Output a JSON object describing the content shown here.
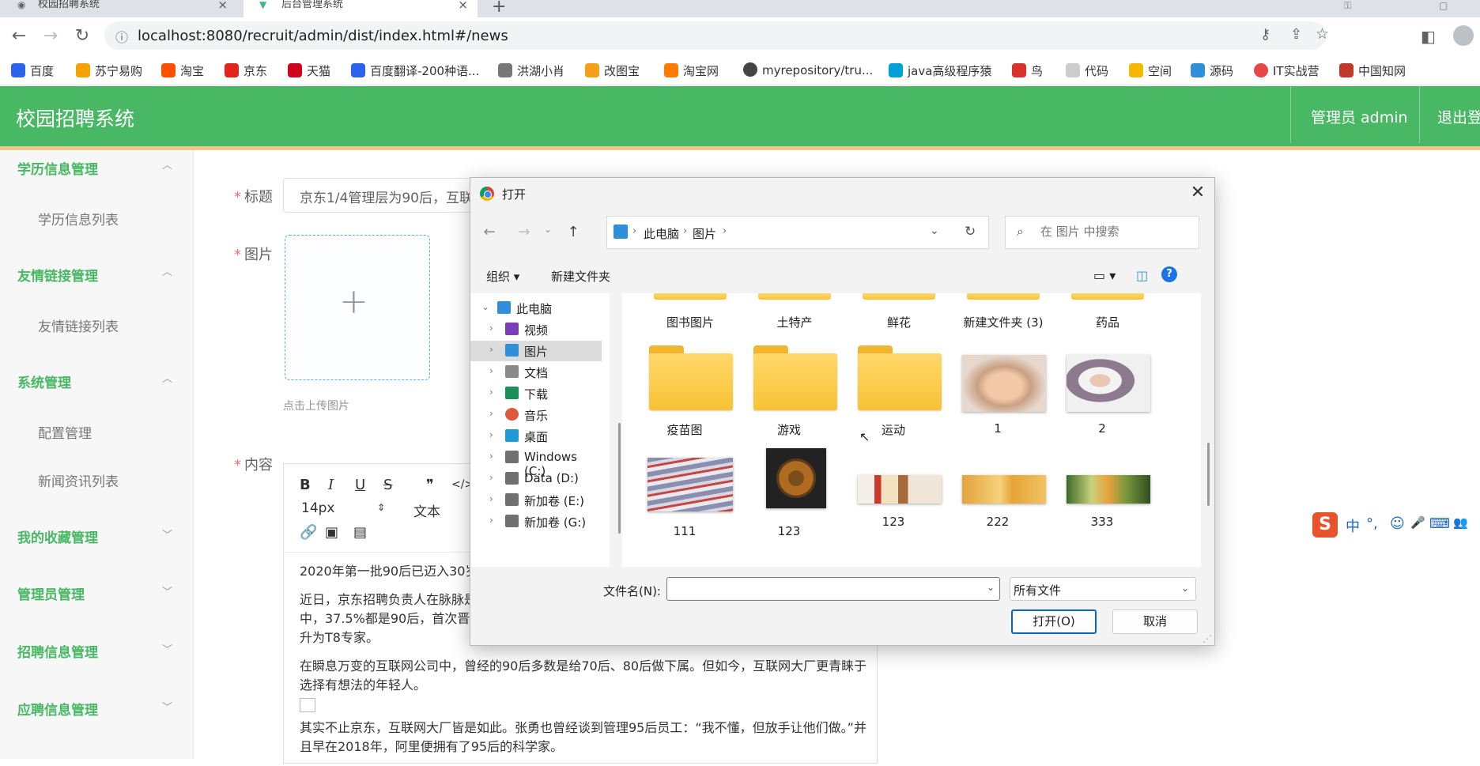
{
  "browser": {
    "tabs": [
      {
        "title": "校园招聘系统"
      },
      {
        "title": "后台管理系统"
      }
    ],
    "new_tab": "+",
    "url": "localhost:8080/recruit/admin/dist/index.html#/news",
    "bookmarks": [
      {
        "label": "百度",
        "color": "#2d63e8"
      },
      {
        "label": "苏宁易购",
        "color": "#f4a300"
      },
      {
        "label": "淘宝",
        "color": "#ff5000"
      },
      {
        "label": "京东",
        "color": "#e1251b"
      },
      {
        "label": "天猫",
        "color": "#d0021b"
      },
      {
        "label": "百度翻译-200种语...",
        "color": "#2d63e8"
      },
      {
        "label": "洪湖小肖",
        "color": "#777777"
      },
      {
        "label": "改图宝",
        "color": "#f6a01a"
      },
      {
        "label": "淘宝网",
        "color": "#ff7a00"
      },
      {
        "label": "myrepository/tru...",
        "color": "#444444"
      },
      {
        "label": "java高级程序猿",
        "color": "#00a1d6"
      },
      {
        "label": "鸟",
        "color": "#d8322a"
      },
      {
        "label": "代码",
        "color": "#cccccc"
      },
      {
        "label": "空间",
        "color": "#f5b700"
      },
      {
        "label": "源码",
        "color": "#2f8fd8"
      },
      {
        "label": "IT实战营",
        "color": "#e84545"
      },
      {
        "label": "中国知网",
        "color": "#c0392b"
      }
    ]
  },
  "app": {
    "title": "校园招聘系统",
    "admin_label": "管理员 admin",
    "logout_label": "退出登录",
    "brand_color": "#48b864"
  },
  "sidebar": {
    "groups": [
      {
        "title": "学历信息管理",
        "items": [
          "学历信息列表"
        ]
      },
      {
        "title": "友情链接管理",
        "items": [
          "友情链接列表"
        ]
      },
      {
        "title": "系统管理",
        "items": [
          "配置管理",
          "新闻资讯列表"
        ]
      },
      {
        "title": "我的收藏管理",
        "items": []
      },
      {
        "title": "管理员管理",
        "items": []
      },
      {
        "title": "招聘信息管理",
        "items": []
      },
      {
        "title": "应聘信息管理",
        "items": []
      }
    ]
  },
  "form": {
    "title_label": "标题",
    "title_value": "京东1/4管理层为90后，互联",
    "image_label": "图片",
    "upload_tip": "点击上传图片",
    "content_label": "内容",
    "required_mark": "*",
    "toolbar": {
      "bold": "B",
      "italic": "I",
      "underline": "U",
      "strike": "S",
      "quote": "❞",
      "code": "</>",
      "font_size": "14px",
      "font_size_arrow": "⇕",
      "text": "文本"
    },
    "content_paragraphs": [
      "2020年第一批90后已迈入30岁，人。",
      "近日，京东招聘负责人在脉脉是内部培养的，1/4以上的管理者都是90后。并且在2020年年初的晋升中，37.5%都是90后，首次晋升的95后，占比达到11.7%。据悉，更有技术类员工，在毕业3年便晋升为T8专家。",
      "在瞬息万变的互联网公司中，曾经的90后多数是给70后、80后做下属。但如今，互联网大厂更青睐于选择有想法的年轻人。",
      "其实不止京东，互联网大厂皆是如此。张勇也曾经谈到管理95后员工：“我不懂，但放手让他们做。”并且早在2018年，阿里便拥有了95后的科学家。"
    ]
  },
  "file_dialog": {
    "title": "打开",
    "breadcrumb": [
      "此电脑",
      "图片"
    ],
    "search_placeholder": "在 图片 中搜索",
    "organize": "组织",
    "new_folder": "新建文件夹",
    "help": "?",
    "tree": [
      {
        "label": "此电脑",
        "color": "#2f8fd8",
        "expanded": true
      },
      {
        "label": "视频",
        "color": "#7a3fb8"
      },
      {
        "label": "图片",
        "color": "#2f8fd8",
        "selected": true
      },
      {
        "label": "文档",
        "color": "#8a8a8a"
      },
      {
        "label": "下载",
        "color": "#1a8f5a"
      },
      {
        "label": "音乐",
        "color": "#e0583a"
      },
      {
        "label": "桌面",
        "color": "#1e9ad6"
      },
      {
        "label": "Windows (C:)",
        "color": "#707070"
      },
      {
        "label": "Data (D:)",
        "color": "#707070"
      },
      {
        "label": "新加卷 (E:)",
        "color": "#707070"
      },
      {
        "label": "新加卷 (G:)",
        "color": "#707070"
      }
    ],
    "items_row1": [
      "图书图片",
      "土特产",
      "鲜花",
      "新建文件夹 (3)",
      "药品"
    ],
    "items_row2": [
      {
        "label": "疫苗图",
        "kind": "folder"
      },
      {
        "label": "游戏",
        "kind": "folder"
      },
      {
        "label": "运动",
        "kind": "folder"
      },
      {
        "label": "1",
        "kind": "photo-face"
      },
      {
        "label": "2",
        "kind": "photo-man"
      }
    ],
    "items_row3": [
      {
        "label": "111",
        "kind": "photo-magazines"
      },
      {
        "label": "123",
        "kind": "photo-soup"
      },
      {
        "label": "123",
        "kind": "photo-banner-food"
      },
      {
        "label": "222",
        "kind": "photo-banner-gold"
      },
      {
        "label": "333",
        "kind": "photo-banner-fruit"
      }
    ],
    "filename_label": "文件名(N):",
    "filename_value": "",
    "filetype_value": "所有文件",
    "open_button": "打开(O)",
    "cancel_button": "取消"
  },
  "ime": {
    "logo": "S",
    "items": [
      "中",
      "°,",
      "☺",
      "🎤",
      "⌨",
      "👥"
    ]
  }
}
